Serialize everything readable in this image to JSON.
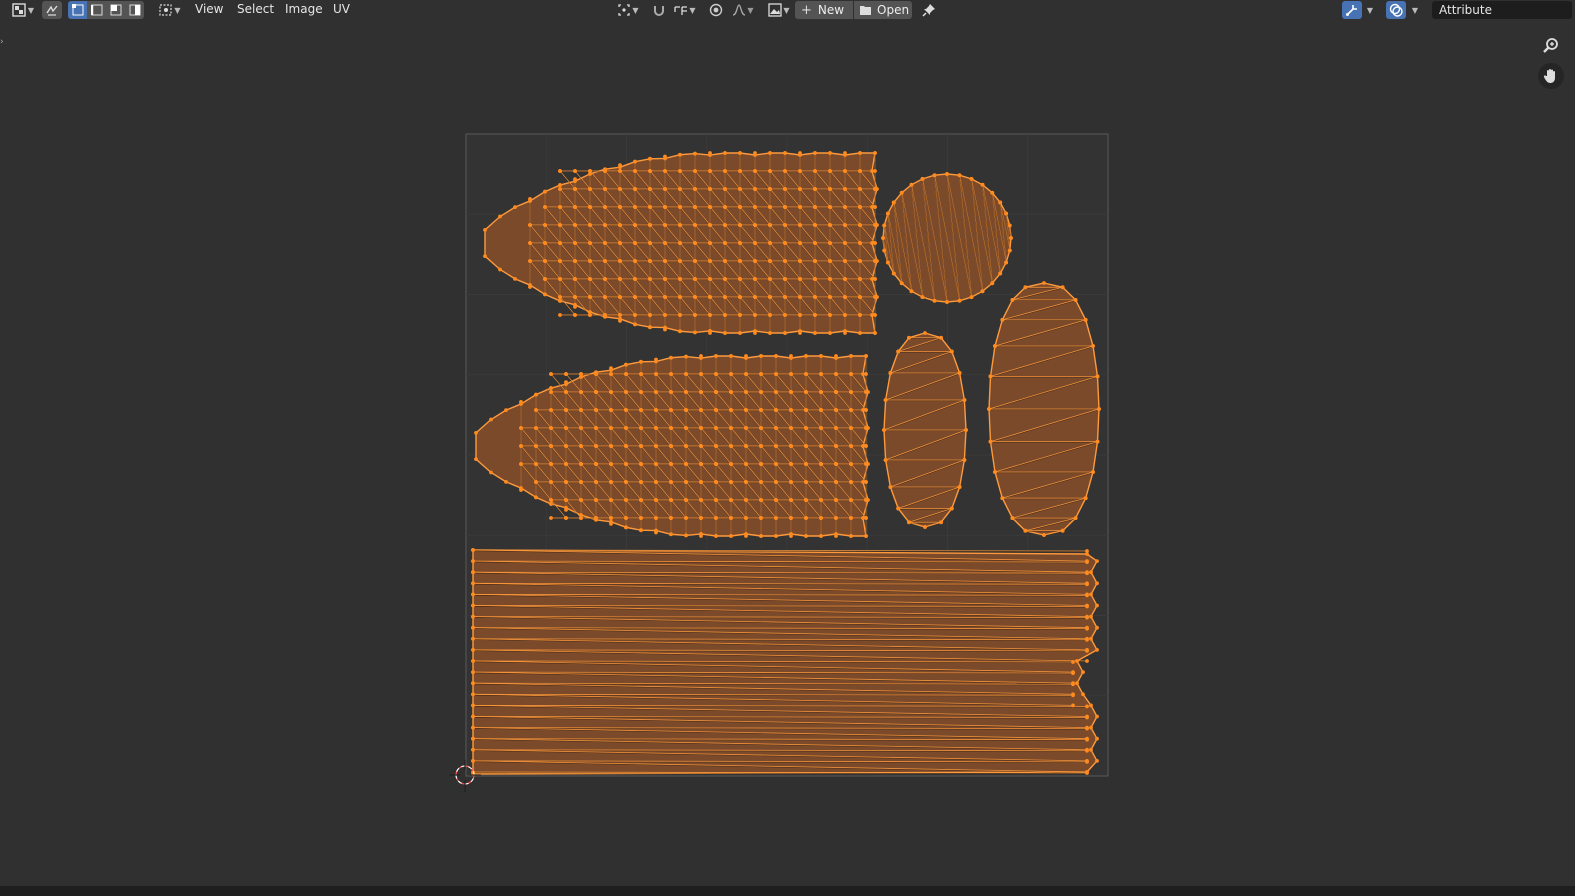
{
  "header": {
    "menus": {
      "view": "View",
      "select": "Select",
      "image": "Image",
      "uv": "UV"
    },
    "new_label": "New",
    "open_label": "Open",
    "attribute_field": "Attribute",
    "mode_icons": [
      "editor-type-icon",
      "sync-selection-icon",
      "vertex-select-icon",
      "edge-select-icon",
      "face-select-icon",
      "island-select-icon",
      "sticky-select-icon"
    ]
  },
  "colors": {
    "background": "#303030",
    "header": "#303030",
    "active_button": "#4772b3",
    "uv_fill": "#7a4a2b",
    "uv_edge": "#ff9a3c",
    "uv_vertex": "#ff8a1e",
    "grid": "#3a3a3a"
  }
}
